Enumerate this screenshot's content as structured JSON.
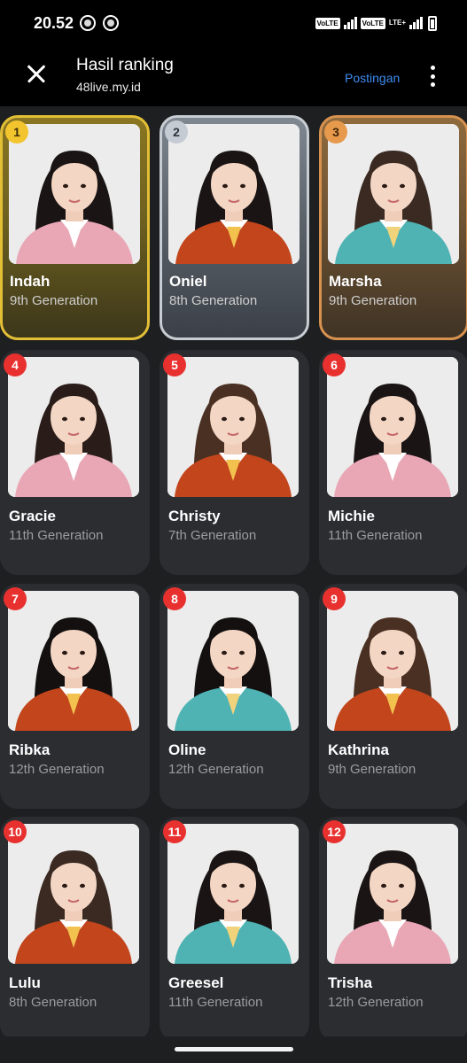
{
  "status_bar": {
    "time": "20.52",
    "volte_1": "VoLTE",
    "volte_2": "VoLTE",
    "lte": "LTE+"
  },
  "app_bar": {
    "title": "Hasil ranking",
    "url": "48live.my.id",
    "post_link": "Postingan"
  },
  "members": [
    {
      "rank": "1",
      "name": "Indah",
      "generation": "9th Generation",
      "tier": "gold",
      "uniform": "pink",
      "uniform_color": "#e9a7b6",
      "hair_color": "#1a1414"
    },
    {
      "rank": "2",
      "name": "Oniel",
      "generation": "8th Generation",
      "tier": "silver",
      "uniform": "orange",
      "uniform_color": "#c2451c",
      "hair_color": "#1a1414"
    },
    {
      "rank": "3",
      "name": "Marsha",
      "generation": "9th Generation",
      "tier": "bronze",
      "uniform": "teal",
      "uniform_color": "#4fb3b4",
      "hair_color": "#3a2a22"
    },
    {
      "rank": "4",
      "name": "Gracie",
      "generation": "11th Generation",
      "tier": "normal",
      "uniform": "pink",
      "uniform_color": "#e9a7b6",
      "hair_color": "#2a1d19"
    },
    {
      "rank": "5",
      "name": "Christy",
      "generation": "7th Generation",
      "tier": "normal",
      "uniform": "orange",
      "uniform_color": "#c2451c",
      "hair_color": "#4a3023"
    },
    {
      "rank": "6",
      "name": "Michie",
      "generation": "11th Generation",
      "tier": "normal",
      "uniform": "pink",
      "uniform_color": "#e9a7b6",
      "hair_color": "#1a1414"
    },
    {
      "rank": "7",
      "name": "Ribka",
      "generation": "12th Generation",
      "tier": "normal",
      "uniform": "orange",
      "uniform_color": "#c2451c",
      "hair_color": "#141010"
    },
    {
      "rank": "8",
      "name": "Oline",
      "generation": "12th Generation",
      "tier": "normal",
      "uniform": "teal",
      "uniform_color": "#4fb3b4",
      "hair_color": "#141010"
    },
    {
      "rank": "9",
      "name": "Kathrina",
      "generation": "9th Generation",
      "tier": "normal",
      "uniform": "orange",
      "uniform_color": "#c2451c",
      "hair_color": "#4a3023"
    },
    {
      "rank": "10",
      "name": "Lulu",
      "generation": "8th Generation",
      "tier": "normal",
      "uniform": "orange",
      "uniform_color": "#c2451c",
      "hair_color": "#3a2a22"
    },
    {
      "rank": "11",
      "name": "Greesel",
      "generation": "11th Generation",
      "tier": "normal",
      "uniform": "teal",
      "uniform_color": "#4fb3b4",
      "hair_color": "#1a1414"
    },
    {
      "rank": "12",
      "name": "Trisha",
      "generation": "12th Generation",
      "tier": "normal",
      "uniform": "pink",
      "uniform_color": "#e9a7b6",
      "hair_color": "#1a1414"
    }
  ],
  "colors": {
    "accent_link": "#3d8cf0",
    "rank_badge": "#e8312f",
    "gold_border": "#e3bf36",
    "silver_border": "#c8cdd3",
    "bronze_border": "#d7924f",
    "card_bg": "#2b2d31",
    "page_bg": "#1e1f21"
  }
}
